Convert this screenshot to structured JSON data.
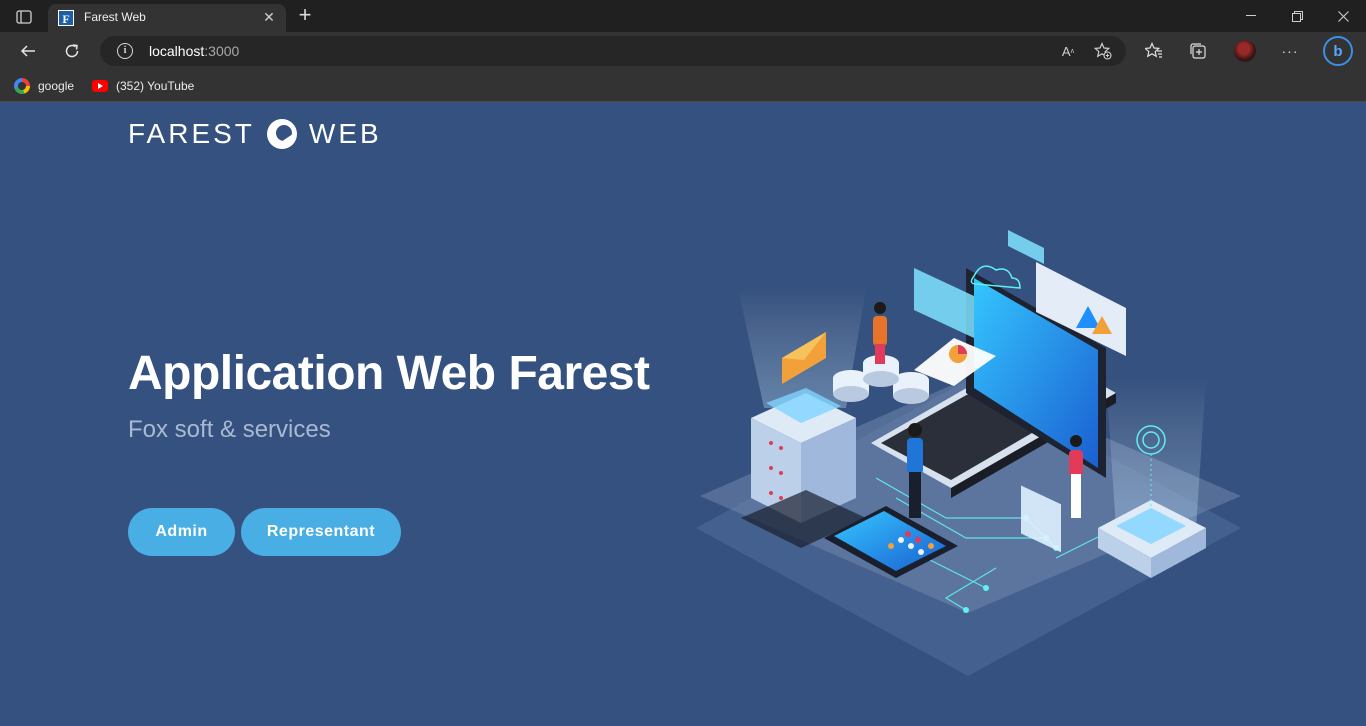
{
  "browser": {
    "tab_title": "Farest Web",
    "favicon_letter": "F",
    "address": {
      "host": "localhost",
      "port": ":3000"
    },
    "bookmarks": [
      {
        "label": "google",
        "icon": "google-icon"
      },
      {
        "label": "(352) YouTube",
        "icon": "youtube-icon"
      }
    ]
  },
  "page": {
    "logo_left": "FAREST",
    "logo_right": "WEB",
    "title": "Application Web Farest",
    "subtitle": "Fox soft & services",
    "buttons": {
      "admin": "Admin",
      "representant": "Representant"
    },
    "illustration_icon": "isometric-tech-illustration"
  },
  "colors": {
    "page_background": "#35517f",
    "button": "#48aee4",
    "subtitle": "#a9b9d3",
    "chrome_dark": "#202020",
    "chrome_toolbar": "#333333"
  }
}
